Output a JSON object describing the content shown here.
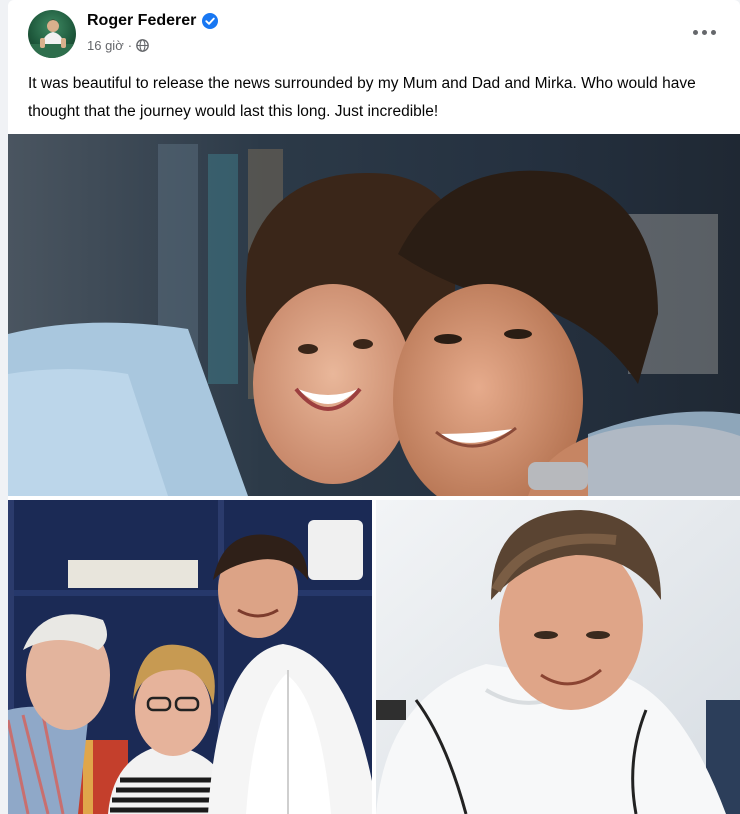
{
  "post": {
    "author": "Roger Federer",
    "verified": true,
    "timestamp": "16 giờ",
    "separator": "·",
    "audience_icon": "globe-icon",
    "more_icon": "more-options-icon",
    "text": "It was beautiful to release the news surrounded by my Mum and Dad and Mirka. Who would have thought that the journey would last this long. Just incredible!"
  },
  "photos": [
    {
      "name": "photo-couple-closeup"
    },
    {
      "name": "photo-with-parents"
    },
    {
      "name": "photo-smiling-down"
    }
  ],
  "colors": {
    "verified": "#1877f2",
    "meta_text": "#65676b",
    "background": "#f0f2f5"
  }
}
